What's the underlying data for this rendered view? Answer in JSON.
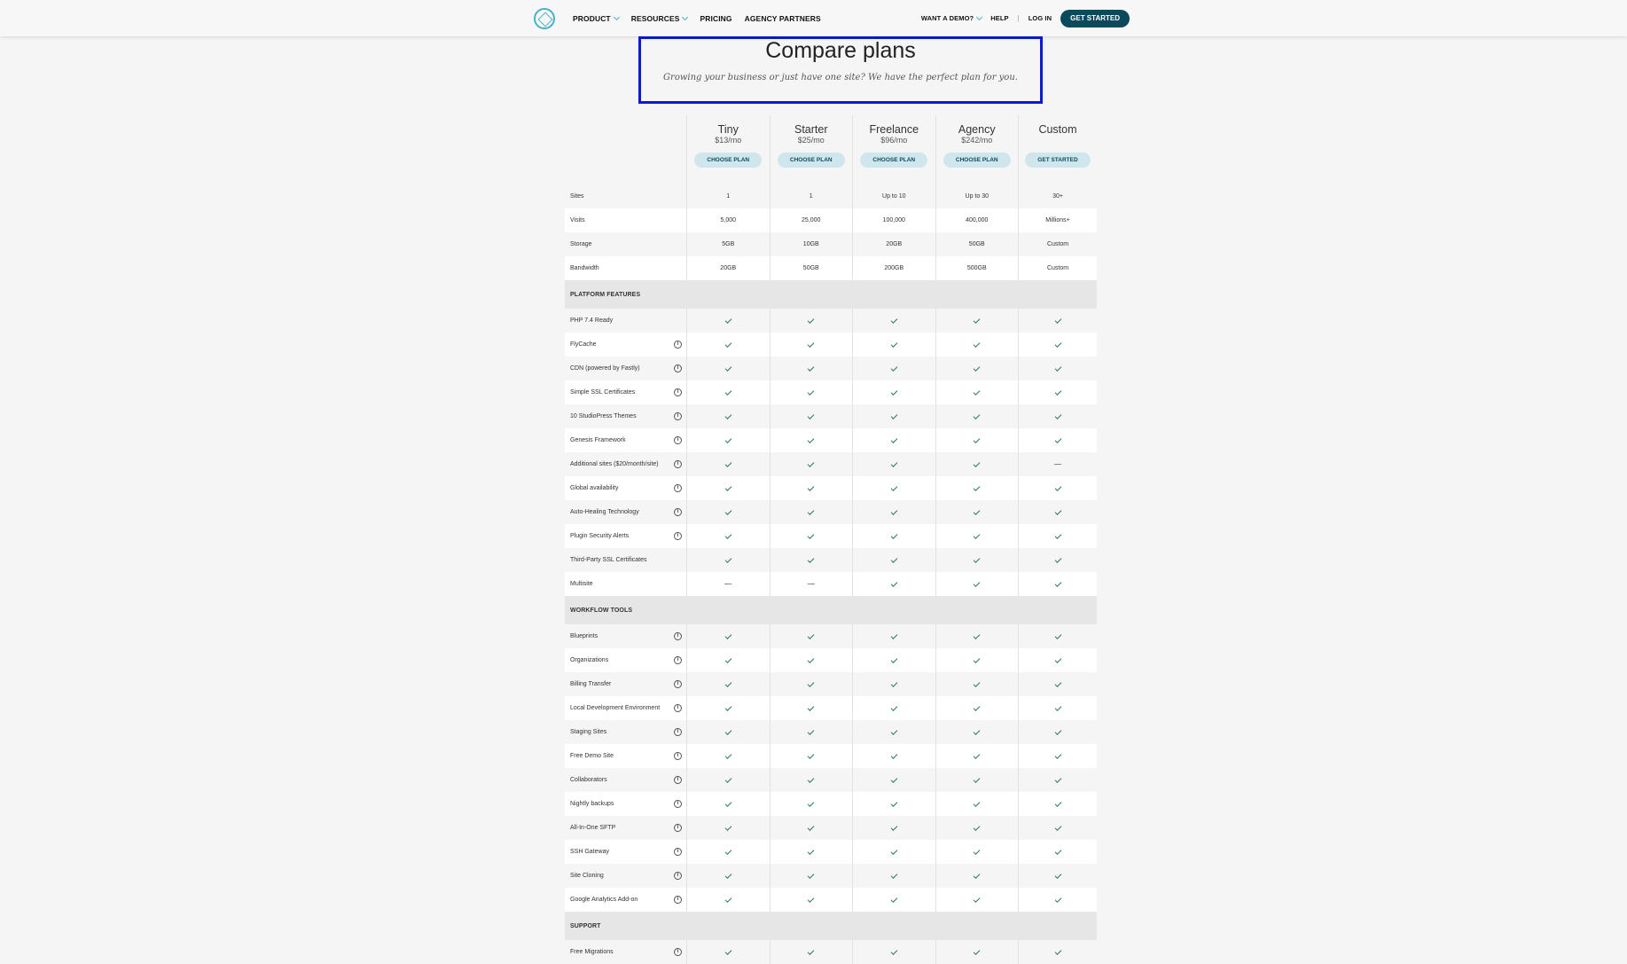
{
  "nav": {
    "links": [
      "PRODUCT",
      "RESOURCES",
      "PRICING",
      "AGENCY PARTNERS"
    ],
    "demo": "WANT A DEMO?",
    "help": "HELP",
    "sep": "|",
    "login": "LOG IN",
    "cta": "GET STARTED"
  },
  "hero": {
    "title": "Compare plans",
    "subtitle": "Growing your business or just have one site? We have the perfect plan for you."
  },
  "plans": [
    {
      "name": "Tiny",
      "price": "$13/mo",
      "button": "CHOOSE PLAN"
    },
    {
      "name": "Starter",
      "price": "$25/mo",
      "button": "CHOOSE PLAN"
    },
    {
      "name": "Freelance",
      "price": "$96/mo",
      "button": "CHOOSE PLAN"
    },
    {
      "name": "Agency",
      "price": "$242/mo",
      "button": "CHOOSE PLAN"
    },
    {
      "name": "Custom",
      "price": "",
      "button": "GET STARTED"
    }
  ],
  "limits": [
    {
      "label": "Sites",
      "values": [
        "1",
        "1",
        "Up to 10",
        "Up to 30",
        "30+"
      ]
    },
    {
      "label": "Visits",
      "values": [
        "5,000",
        "25,000",
        "100,000",
        "400,000",
        "Millions+"
      ]
    },
    {
      "label": "Storage",
      "values": [
        "5GB",
        "10GB",
        "20GB",
        "50GB",
        "Custom"
      ]
    },
    {
      "label": "Bandwidth",
      "values": [
        "20GB",
        "50GB",
        "200GB",
        "500GB",
        "Custom"
      ]
    }
  ],
  "sections": [
    {
      "title": "PLATFORM FEATURES",
      "rows": [
        {
          "label": "PHP 7.4 Ready",
          "info": false,
          "values": [
            "check",
            "check",
            "check",
            "check",
            "check"
          ]
        },
        {
          "label": "FlyCache",
          "info": true,
          "values": [
            "check",
            "check",
            "check",
            "check",
            "check"
          ]
        },
        {
          "label": "CDN (powered by Fastly)",
          "info": true,
          "values": [
            "check",
            "check",
            "check",
            "check",
            "check"
          ]
        },
        {
          "label": "Simple SSL Certificates",
          "info": true,
          "values": [
            "check",
            "check",
            "check",
            "check",
            "check"
          ]
        },
        {
          "label": "10 StudioPress Themes",
          "info": true,
          "values": [
            "check",
            "check",
            "check",
            "check",
            "check"
          ]
        },
        {
          "label": "Genesis Framework",
          "info": true,
          "values": [
            "check",
            "check",
            "check",
            "check",
            "check"
          ]
        },
        {
          "label": "Additional sites ($20/month/site)",
          "info": true,
          "values": [
            "check",
            "check",
            "check",
            "check",
            "dash"
          ]
        },
        {
          "label": "Global availability",
          "info": true,
          "values": [
            "check",
            "check",
            "check",
            "check",
            "check"
          ]
        },
        {
          "label": "Auto-Healing Technology",
          "info": true,
          "values": [
            "check",
            "check",
            "check",
            "check",
            "check"
          ]
        },
        {
          "label": "Plugin Security Alerts",
          "info": true,
          "values": [
            "check",
            "check",
            "check",
            "check",
            "check"
          ]
        },
        {
          "label": "Third-Party SSL Certificates",
          "info": false,
          "values": [
            "check",
            "check",
            "check",
            "check",
            "check"
          ]
        },
        {
          "label": "Multisite",
          "info": false,
          "values": [
            "dash",
            "dash",
            "check",
            "check",
            "check"
          ]
        }
      ]
    },
    {
      "title": "WORKFLOW TOOLS",
      "rows": [
        {
          "label": "Blueprints",
          "info": true,
          "values": [
            "check",
            "check",
            "check",
            "check",
            "check"
          ]
        },
        {
          "label": "Organizations",
          "info": true,
          "values": [
            "check",
            "check",
            "check",
            "check",
            "check"
          ]
        },
        {
          "label": "Billing Transfer",
          "info": true,
          "values": [
            "check",
            "check",
            "check",
            "check",
            "check"
          ]
        },
        {
          "label": "Local Development Environment",
          "info": true,
          "values": [
            "check",
            "check",
            "check",
            "check",
            "check"
          ]
        },
        {
          "label": "Staging Sites",
          "info": true,
          "values": [
            "check",
            "check",
            "check",
            "check",
            "check"
          ]
        },
        {
          "label": "Free Demo Site",
          "info": true,
          "values": [
            "check",
            "check",
            "check",
            "check",
            "check"
          ]
        },
        {
          "label": "Collaborators",
          "info": true,
          "values": [
            "check",
            "check",
            "check",
            "check",
            "check"
          ]
        },
        {
          "label": "Nightly backups",
          "info": true,
          "values": [
            "check",
            "check",
            "check",
            "check",
            "check"
          ]
        },
        {
          "label": "All-In-One SFTP",
          "info": true,
          "values": [
            "check",
            "check",
            "check",
            "check",
            "check"
          ]
        },
        {
          "label": "SSH Gateway",
          "info": true,
          "values": [
            "check",
            "check",
            "check",
            "check",
            "check"
          ]
        },
        {
          "label": "Site Cloning",
          "info": true,
          "values": [
            "check",
            "check",
            "check",
            "check",
            "check"
          ]
        },
        {
          "label": "Google Analytics Add-on",
          "info": true,
          "values": [
            "check",
            "check",
            "check",
            "check",
            "check"
          ]
        }
      ]
    },
    {
      "title": "SUPPORT",
      "rows": [
        {
          "label": "Free Migrations",
          "info": true,
          "values": [
            "check",
            "check",
            "check",
            "check",
            "check"
          ]
        }
      ]
    }
  ],
  "icons": {
    "info": "info-icon",
    "check": "checkmark-icon",
    "dash": "dash-icon"
  },
  "colors": {
    "accent": "#46b3c4",
    "cta": "#0b4a5c",
    "check": "#2a7a52",
    "highlight": "#0a19d8"
  }
}
